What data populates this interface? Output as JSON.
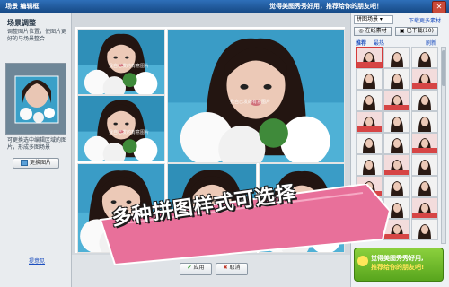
{
  "window": {
    "title": "场景 编辑框",
    "center_text": "觉得美图秀秀好用，推荐给你的朋友吧！",
    "close_glyph": "✕"
  },
  "left": {
    "scene_title": "场景调整",
    "scene_desc": "调整图片位置，使图片更好的与场景整合",
    "replace_hint": "可更换选中编辑区域的图片，形成多图场景",
    "replace_button": "更换图片",
    "feedback": "提意见"
  },
  "collage": {
    "watermark": "我自己发的有意图片"
  },
  "bottom": {
    "ok_button": "应用",
    "cancel_button": "取消"
  },
  "right": {
    "select_value": "拼图场景",
    "download_more": "下载更多素材",
    "online_button": "在线素材",
    "downloaded_button": "已下载(10)",
    "tab_recommend": "推荐",
    "tab_hot": "最热",
    "refresh": "刷新",
    "promo_line1": "觉得美图秀秀好用,",
    "promo_line2": "推荐给你的朋友吧!"
  },
  "banner": {
    "text": "多种拼图样式可选择"
  },
  "colors": {
    "title_bar": "#1f5a9e",
    "banner_pink": "#e8709a",
    "promo_green": "#6cbf2a"
  }
}
